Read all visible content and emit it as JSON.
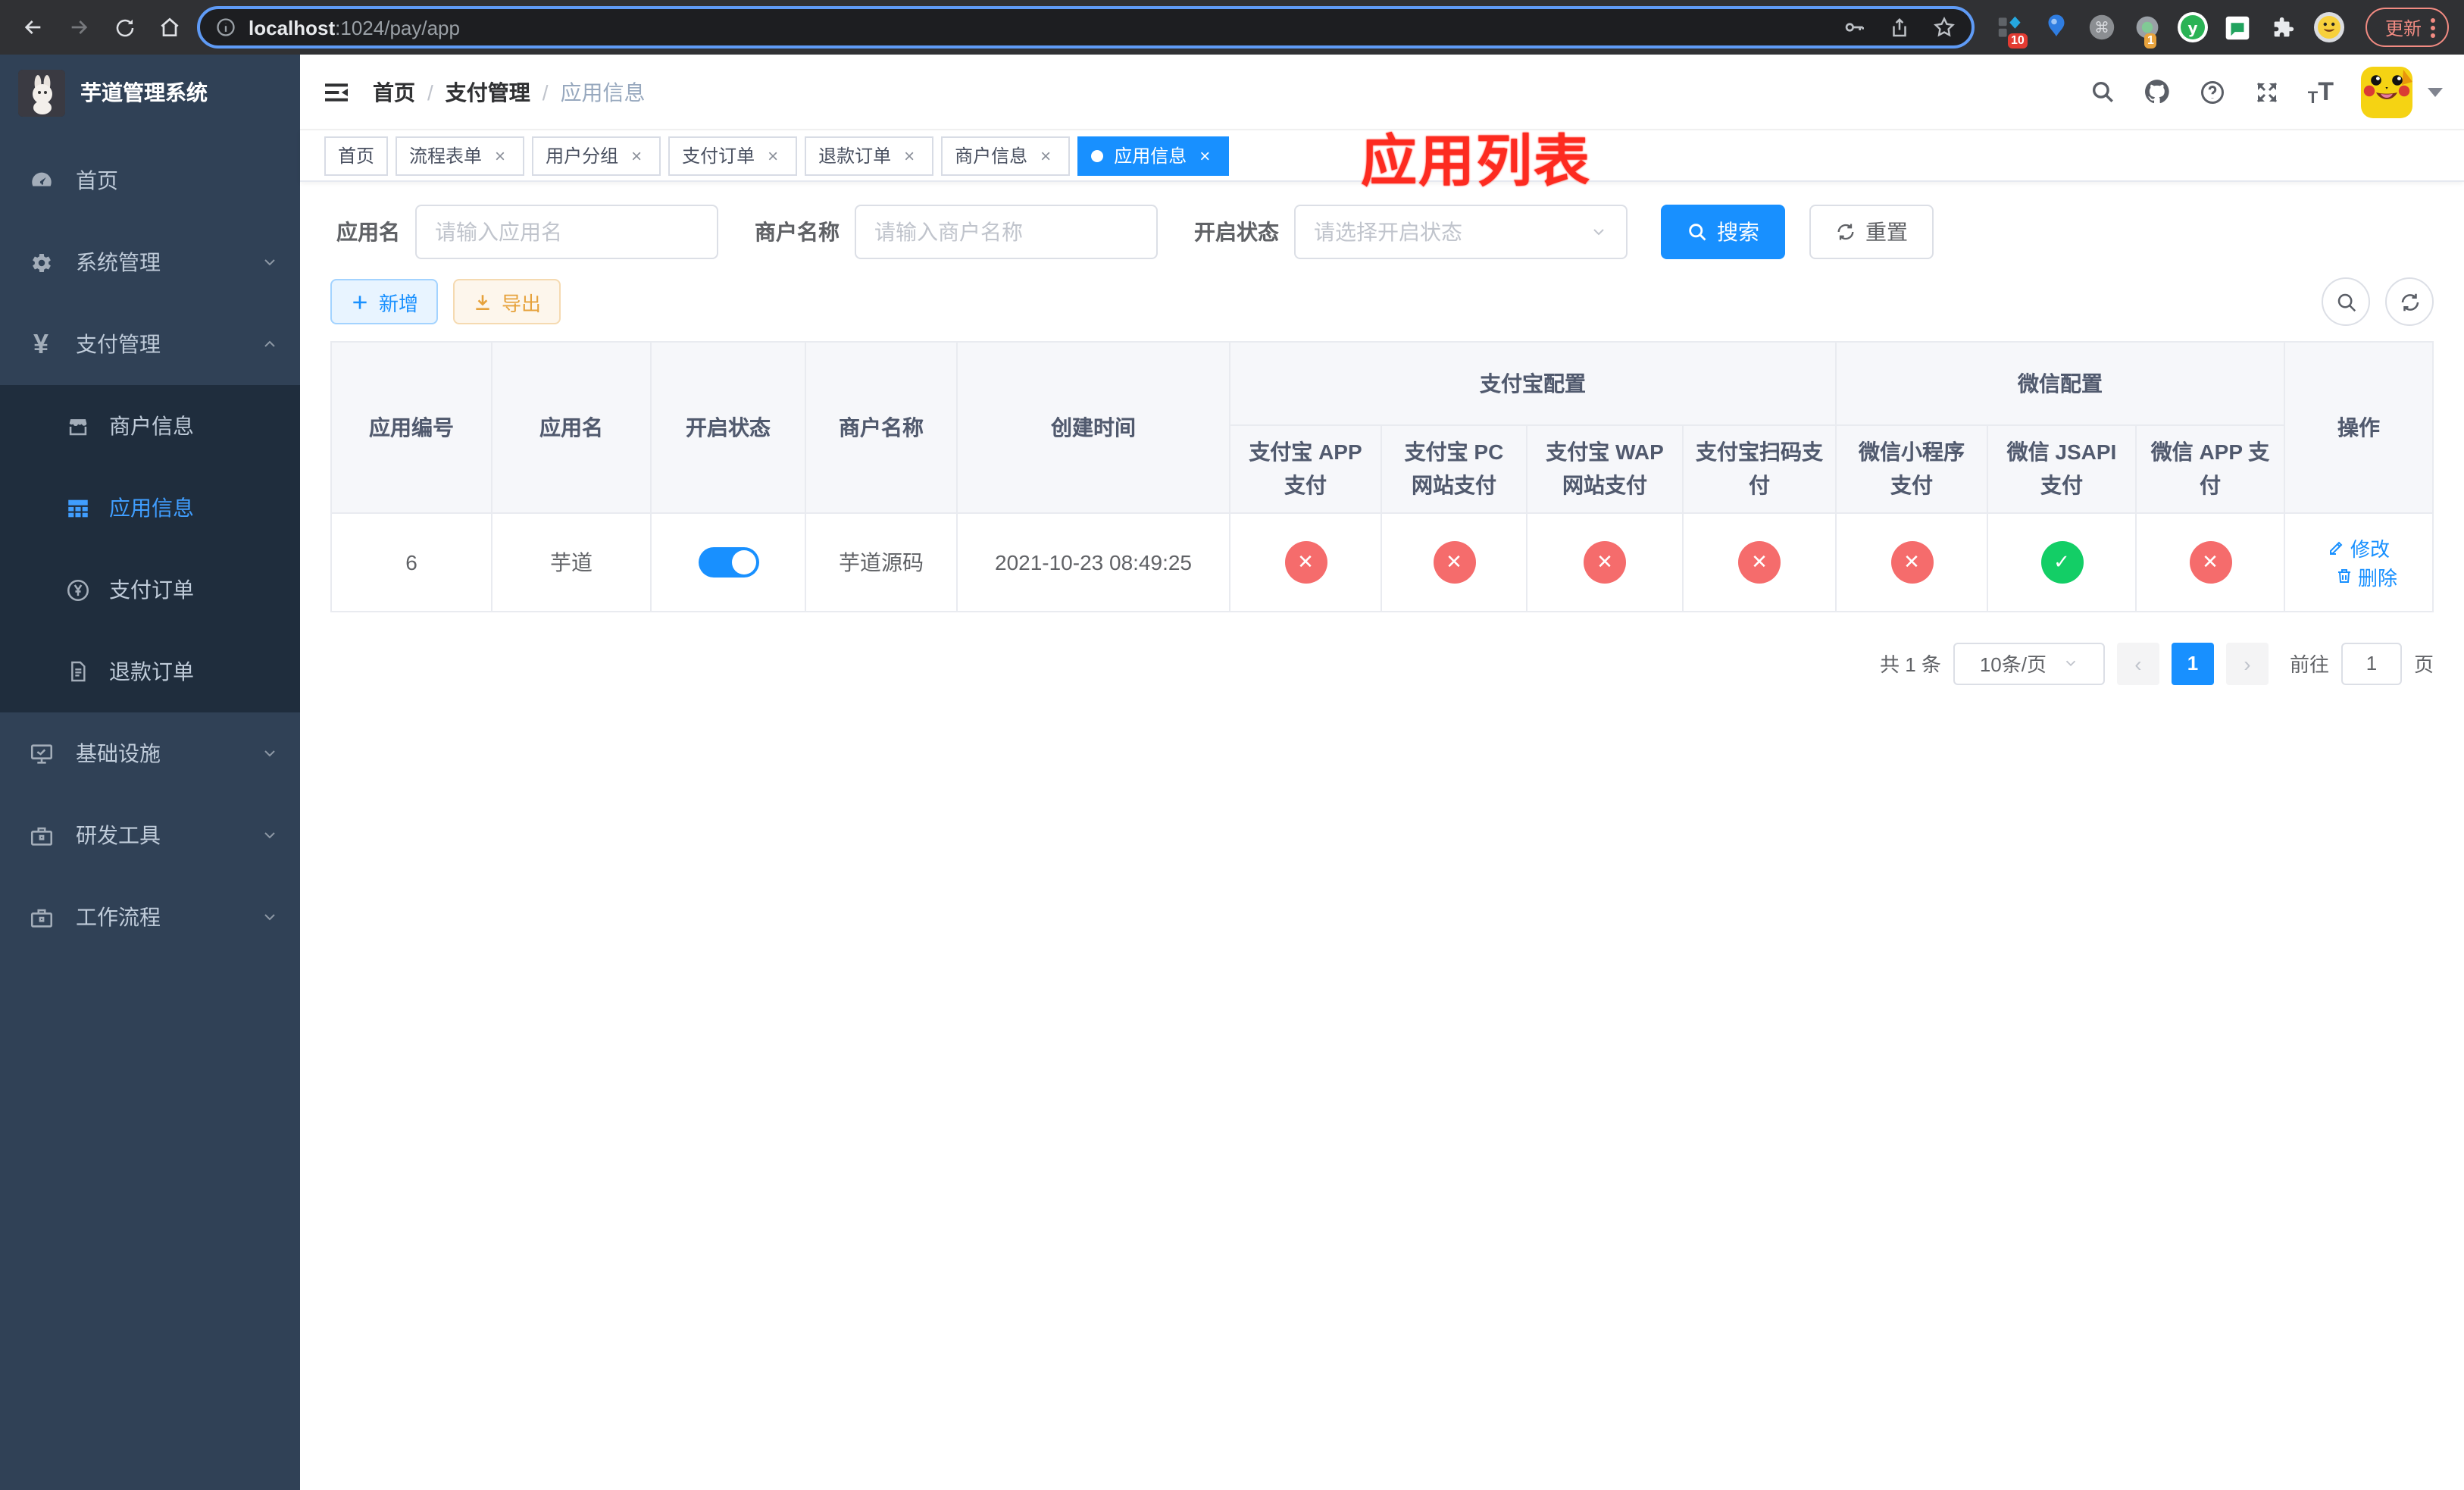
{
  "chrome": {
    "url_host": "localhost",
    "url_path": ":1024/pay/app",
    "update_button": "更新",
    "ext_badge_pink": "10",
    "ext_badge_orange": "1"
  },
  "sidebar": {
    "logo_title": "芋道管理系统",
    "items": {
      "home": "首页",
      "system": "系统管理",
      "payment": "支付管理",
      "infra": "基础设施",
      "devtools": "研发工具",
      "workflow": "工作流程"
    },
    "payment_children": {
      "merchant": "商户信息",
      "app": "应用信息",
      "pay_order": "支付订单",
      "refund_order": "退款订单"
    },
    "yen_glyph": "¥"
  },
  "navbar": {
    "breadcrumb": {
      "home": "首页",
      "payment": "支付管理",
      "current": "应用信息"
    },
    "annotation": "应用列表"
  },
  "tabs": [
    {
      "label": "首页",
      "closable": false,
      "active": false
    },
    {
      "label": "流程表单",
      "closable": true,
      "active": false
    },
    {
      "label": "用户分组",
      "closable": true,
      "active": false
    },
    {
      "label": "支付订单",
      "closable": true,
      "active": false
    },
    {
      "label": "退款订单",
      "closable": true,
      "active": false
    },
    {
      "label": "商户信息",
      "closable": true,
      "active": false
    },
    {
      "label": "应用信息",
      "closable": true,
      "active": true
    }
  ],
  "filters": {
    "app_name_label": "应用名",
    "app_name_placeholder": "请输入应用名",
    "merchant_label": "商户名称",
    "merchant_placeholder": "请输入商户名称",
    "status_label": "开启状态",
    "status_placeholder": "请选择开启状态",
    "search_button": "搜索",
    "reset_button": "重置"
  },
  "toolbar": {
    "add_button": "新增",
    "export_button": "导出"
  },
  "table": {
    "headers": {
      "app_id": "应用编号",
      "app_name": "应用名",
      "status": "开启状态",
      "merchant": "商户名称",
      "created": "创建时间",
      "alipay_group": "支付宝配置",
      "wechat_group": "微信配置",
      "alipay_app": "支付宝 APP 支付",
      "alipay_pc": "支付宝 PC 网站支付",
      "alipay_wap": "支付宝 WAP 网站支付",
      "alipay_qr": "支付宝扫码支付",
      "wx_lite": "微信小程序支付",
      "wx_jsapi": "微信 JSAPI 支付",
      "wx_app": "微信 APP 支付",
      "ops": "操作"
    },
    "row": {
      "id": "6",
      "name": "芋道",
      "enabled": "true",
      "merchant": "芋道源码",
      "created": "2021-10-23 08:49:25",
      "statuses": [
        {
          "state": "fail",
          "glyph": "✕"
        },
        {
          "state": "fail",
          "glyph": "✕"
        },
        {
          "state": "fail",
          "glyph": "✕"
        },
        {
          "state": "fail",
          "glyph": "✕"
        },
        {
          "state": "fail",
          "glyph": "✕"
        },
        {
          "state": "success",
          "glyph": "✓"
        },
        {
          "state": "fail",
          "glyph": "✕"
        }
      ],
      "edit_label": "修改",
      "delete_label": "删除"
    }
  },
  "pagination": {
    "total": "共 1 条",
    "page_size": "10条/页",
    "prev_glyph": "‹",
    "next_glyph": "›",
    "page": "1",
    "goto_label": "前往",
    "goto_value": "1",
    "page_unit": "页"
  },
  "ui": {
    "close_glyph": "×",
    "sep_glyph": "/",
    "t_small": "T",
    "t_big": "T"
  },
  "colors": {
    "accent": "#1890ff",
    "danger": "#f56c6c",
    "success": "#13ce66",
    "warning": "#e6a23c",
    "sidebar": "#304156",
    "submenu": "#1f2d3d"
  }
}
